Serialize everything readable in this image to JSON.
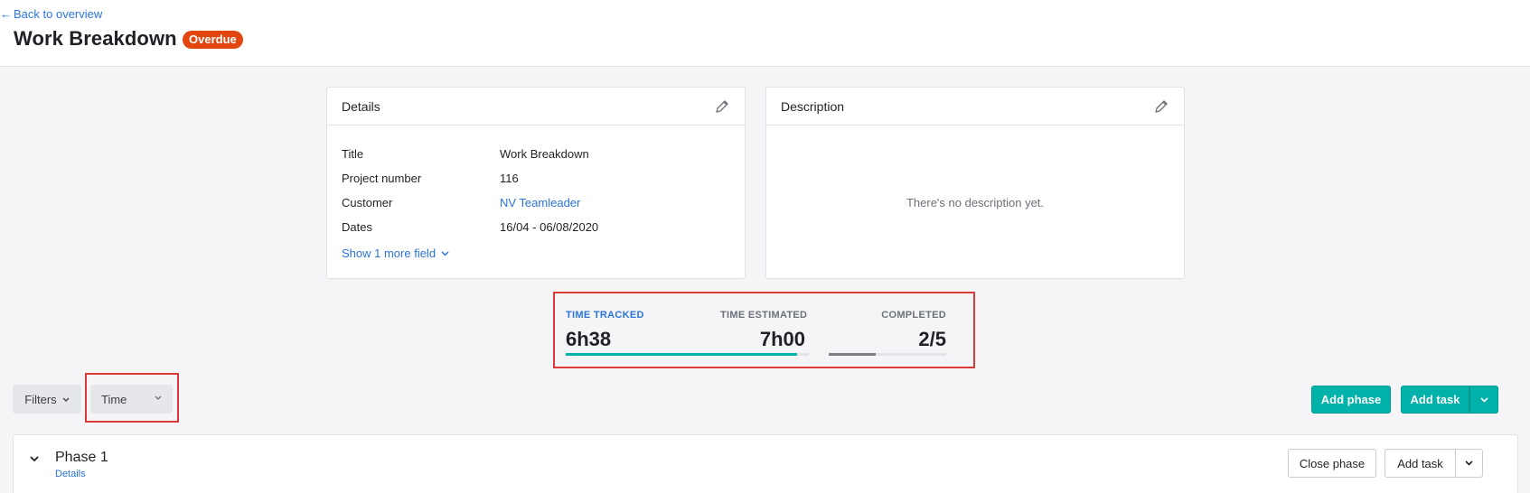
{
  "header": {
    "back_label": "Back to overview",
    "title": "Work Breakdown",
    "status_badge": "Overdue"
  },
  "details": {
    "title": "Details",
    "rows": [
      {
        "label": "Title",
        "value": "Work Breakdown"
      },
      {
        "label": "Project number",
        "value": "116"
      },
      {
        "label": "Customer",
        "value": "NV Teamleader"
      },
      {
        "label": "Dates",
        "value": "16/04 - 06/08/2020"
      }
    ],
    "show_more_label": "Show 1 more field"
  },
  "description": {
    "title": "Description",
    "empty_text": "There's no description yet."
  },
  "stats": {
    "time_tracked_label": "TIME TRACKED",
    "time_tracked_value": "6h38",
    "time_estimated_label": "TIME ESTIMATED",
    "time_estimated_value": "7h00",
    "time_progress": 0.95,
    "completed_label": "COMPLETED",
    "completed_value": "2/5",
    "completed_progress": 0.4
  },
  "toolbar": {
    "filters_label": "Filters",
    "grouping_value": "Time",
    "add_phase_label": "Add phase",
    "add_task_label": "Add task"
  },
  "phase": {
    "title": "Phase 1",
    "details_link": "Details",
    "close_label": "Close phase",
    "add_task_label": "Add task"
  },
  "colors": {
    "accent": "#00b2a9",
    "link": "#2b74de",
    "badge": "#e2460e",
    "highlight": "#d93a3a"
  },
  "icons": {
    "back": "arrow-left-icon",
    "edit": "pencil-icon",
    "dropdown": "chevron-down-icon"
  }
}
